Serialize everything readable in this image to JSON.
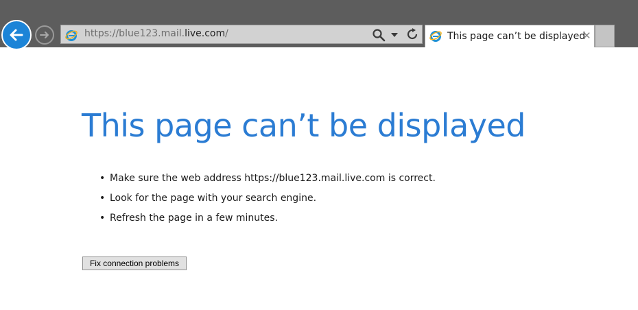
{
  "browser": {
    "address": {
      "url_prefix": "https://blue123.mail.",
      "url_domain": "live.com",
      "url_suffix": "/"
    },
    "tab": {
      "title": "This page can’t be displayed",
      "close_symbol": "✕"
    },
    "accent_color": "#1c84d7"
  },
  "page": {
    "heading": "This page can’t be displayed",
    "tips": [
      "Make sure the web address https://blue123.mail.live.com is correct.",
      "Look for the page with your search engine.",
      "Refresh the page in a few minutes."
    ],
    "fix_button_label": "Fix connection problems",
    "heading_color": "#2b7cd3"
  }
}
